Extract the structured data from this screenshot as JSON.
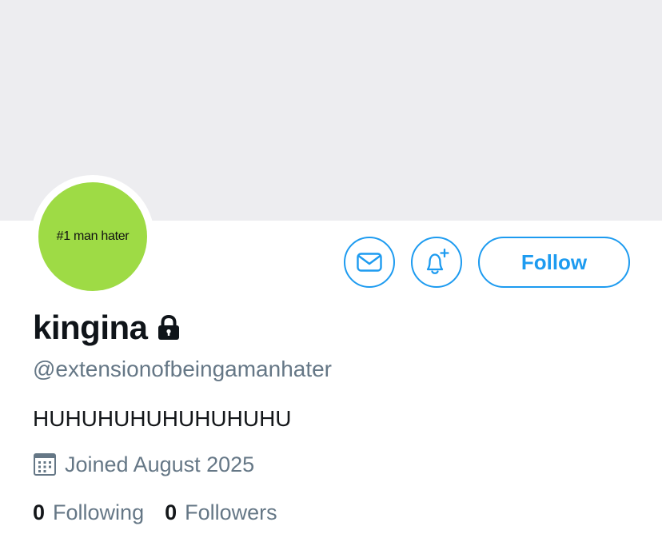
{
  "profile": {
    "display_name": "kingina",
    "handle": "@extensionofbeingamanhater",
    "bio": "HUHUHUHUHUHUHUHU",
    "joined": "Joined August 2025",
    "avatar_text": "#1 man hater",
    "protected_icon": "lock-icon"
  },
  "actions": {
    "message_icon": "envelope-icon",
    "notify_icon": "bell-plus-icon",
    "follow_label": "Follow"
  },
  "stats": {
    "following_count": "0",
    "following_label": "Following",
    "followers_count": "0",
    "followers_label": "Followers"
  },
  "colors": {
    "accent": "#1d9bf0",
    "banner": "#ededf0",
    "avatar_bg": "#9edb45",
    "secondary_text": "#657786"
  }
}
